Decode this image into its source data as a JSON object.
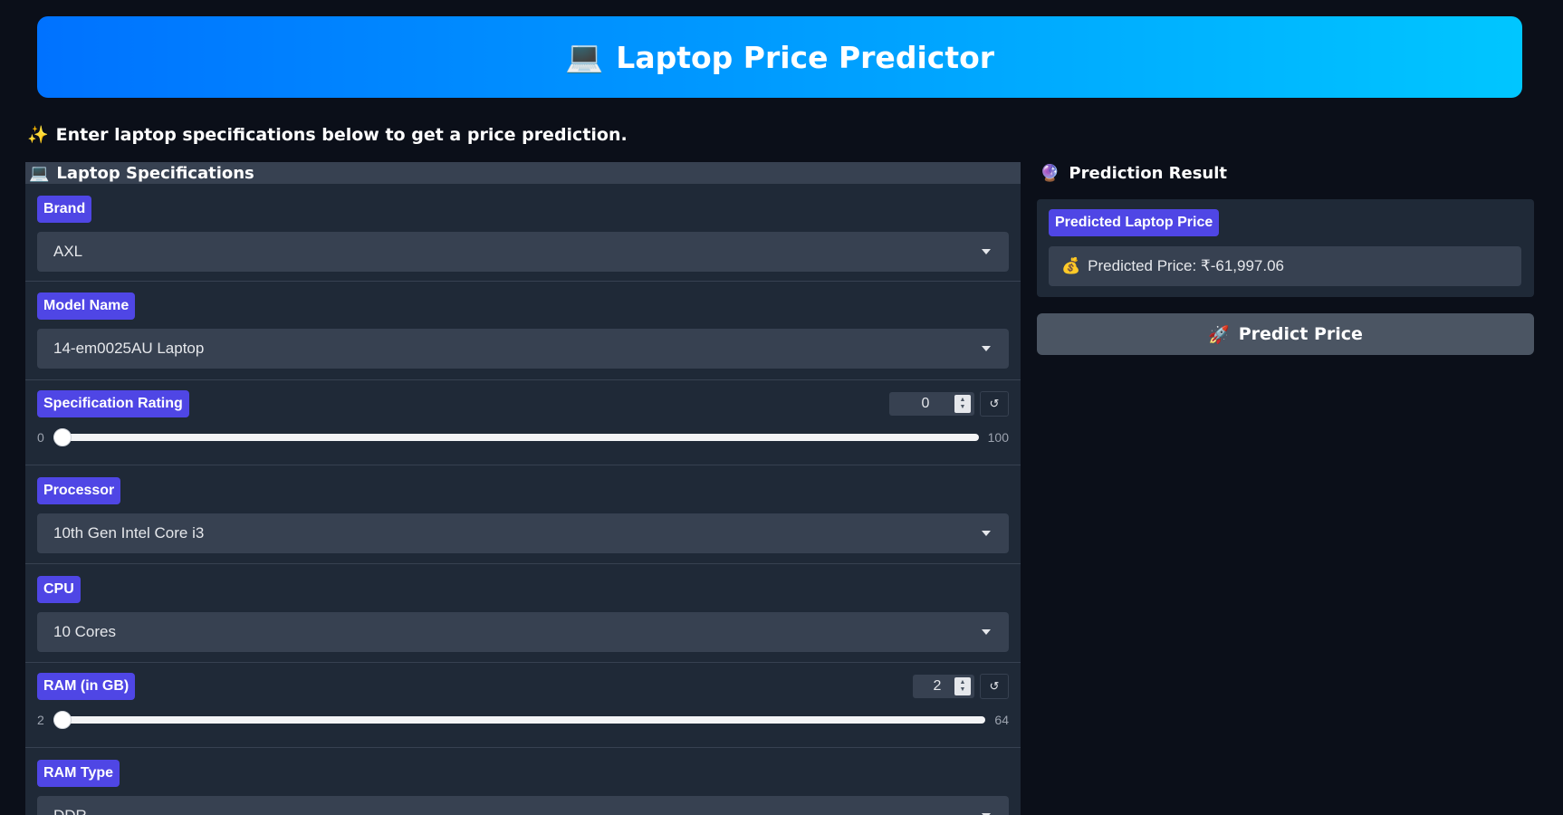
{
  "header": {
    "icon": "laptop-emoji",
    "icon_glyph": "💻",
    "title": "Laptop Price Predictor"
  },
  "intro": {
    "icon_glyph": "✨",
    "text": "Enter laptop specifications below to get a price prediction."
  },
  "specs": {
    "icon_glyph": "💻",
    "title": "Laptop Specifications",
    "brand": {
      "label": "Brand",
      "value": "AXL"
    },
    "model_name": {
      "label": "Model Name",
      "value": "14-em0025AU Laptop"
    },
    "spec_rating": {
      "label": "Specification Rating",
      "value": "0",
      "min": "0",
      "max": "100",
      "fraction": 0.0
    },
    "processor": {
      "label": "Processor",
      "value": "10th Gen Intel Core i3"
    },
    "cpu": {
      "label": "CPU",
      "value": "10 Cores"
    },
    "ram": {
      "label": "RAM (in GB)",
      "value": "2",
      "min": "2",
      "max": "64",
      "fraction": 0.0
    },
    "ram_type": {
      "label": "RAM Type",
      "value": "DDR"
    }
  },
  "result": {
    "icon_glyph": "🔮",
    "title": "Prediction Result",
    "label": "Predicted Laptop Price",
    "value_icon_glyph": "💰",
    "value_text": "Predicted Price: ₹-61,997.06"
  },
  "predict_button": {
    "icon_glyph": "🚀",
    "label": "Predict Price"
  },
  "colors": {
    "background": "#0b0f19",
    "panel": "#1f2937",
    "input": "#374151",
    "label_accent": "#4f46e5",
    "header_gradient_start": "#0072ff",
    "header_gradient_end": "#00c6ff",
    "button": "#4b5563"
  }
}
